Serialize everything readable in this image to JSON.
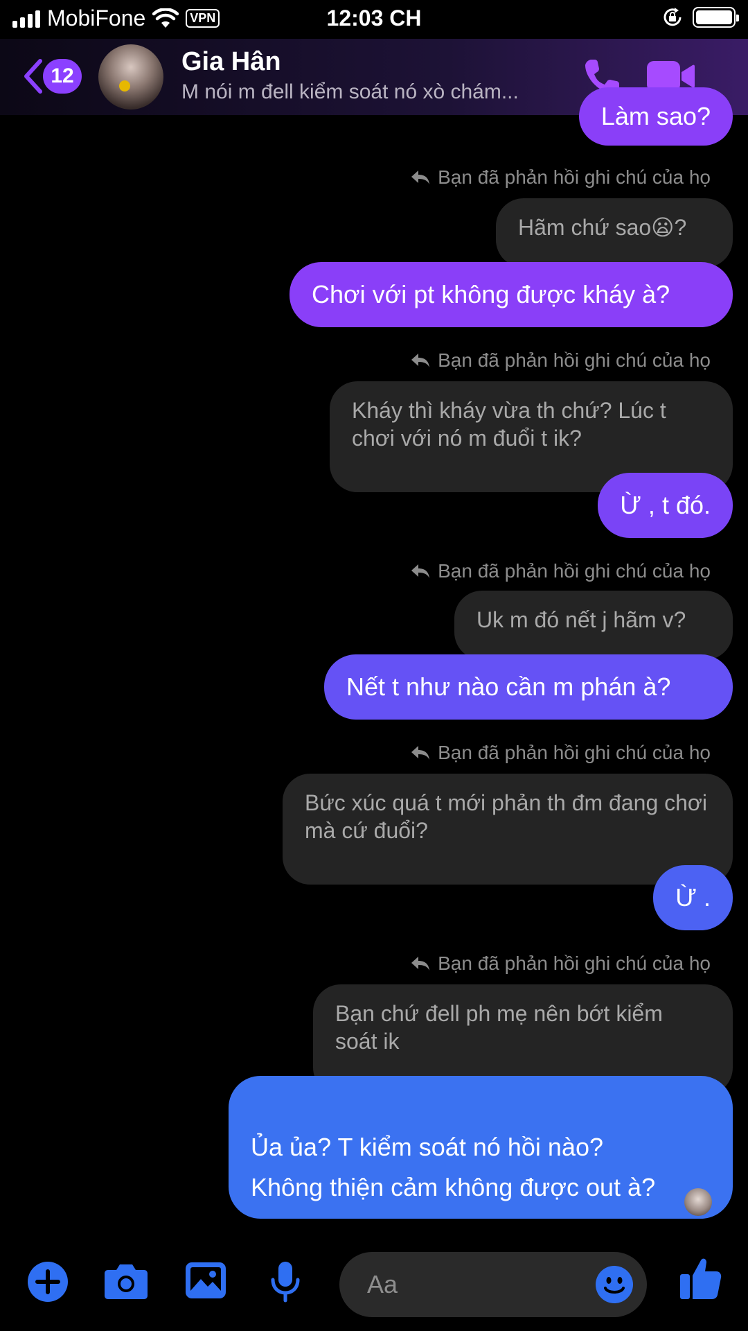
{
  "status_bar": {
    "carrier": "MobiFone",
    "vpn": "VPN",
    "time": "12:03 CH"
  },
  "header": {
    "unread_count": "12",
    "contact_name": "Gia Hân",
    "last_message_preview": "M nói m đell kiểm soát nó xò chám..."
  },
  "messages": [
    {
      "kind": "me",
      "text": "Làm sao?",
      "color": "#8a3ff8"
    },
    {
      "kind": "note",
      "text": "Bạn đã phản hồi ghi chú của họ"
    },
    {
      "kind": "quote",
      "text": "Hãm chứ sao😦?"
    },
    {
      "kind": "me",
      "text": "Chơi với pt không được kháy à?",
      "color": "#8a3ff8"
    },
    {
      "kind": "note",
      "text": "Bạn đã phản hồi ghi chú của họ"
    },
    {
      "kind": "quote",
      "text": "Kháy thì kháy vừa th chứ? Lúc t chơi với nó m đuổi t ik?"
    },
    {
      "kind": "me",
      "text": "Ừ , t đó.",
      "color": "#7a44f6"
    },
    {
      "kind": "note",
      "text": "Bạn đã phản hồi ghi chú của họ"
    },
    {
      "kind": "quote",
      "text": "Uk m đó nết j hãm v?"
    },
    {
      "kind": "me",
      "text": "Nết t như nào cần m phán à?",
      "color": "#6552f5"
    },
    {
      "kind": "note",
      "text": "Bạn đã phản hồi ghi chú của họ"
    },
    {
      "kind": "quote",
      "text": "Bức xúc quá t mới phản th đm đang chơi mà cứ đuổi?"
    },
    {
      "kind": "me",
      "text": "Ừ .",
      "color": "#4c62f3"
    },
    {
      "kind": "note",
      "text": "Bạn đã phản hồi ghi chú của họ"
    },
    {
      "kind": "quote",
      "text": "Bạn chứ đell ph mẹ nên bớt kiểm soát ik"
    },
    {
      "kind": "me",
      "text": "Ủa ủa? T kiểm soát nó hồi nào?\nKhông thiện cảm không được out à?",
      "color": "#3b72f1"
    }
  ],
  "composer": {
    "placeholder": "Aa"
  },
  "icons": {
    "back": "chevron-left-icon",
    "call": "phone-icon",
    "video": "video-camera-icon",
    "plus": "plus-icon",
    "camera": "camera-icon",
    "gallery": "image-icon",
    "mic": "microphone-icon",
    "emoji": "smiley-icon",
    "like": "thumbs-up-icon",
    "reply": "reply-arrow-icon"
  },
  "colors": {
    "accent_purple": "#8b40ff",
    "accent_blue": "#2f6ff2",
    "bubble_gray": "#242424"
  }
}
